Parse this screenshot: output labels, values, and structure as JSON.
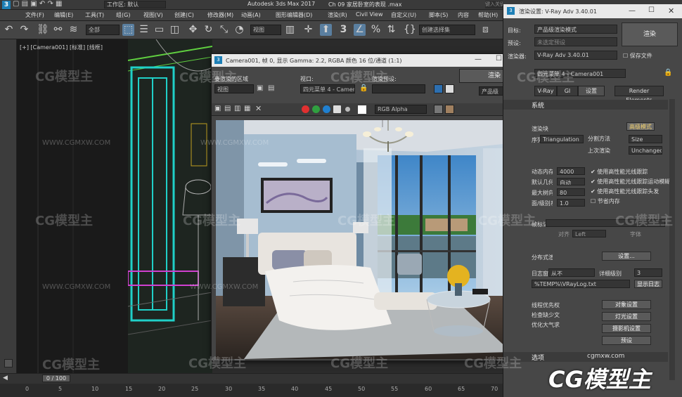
{
  "app": {
    "title": "Autodesk 3ds Max 2017",
    "file": "Ch 09 家居卧室的表现 .max",
    "workspace_label": "工作区: 默认",
    "search_placeholder": "键入关键字或短语"
  },
  "menu": [
    "文件(F)",
    "编辑(E)",
    "工具(T)",
    "组(G)",
    "视图(V)",
    "创建(C)",
    "修改器(M)",
    "动画(A)",
    "图形编辑器(D)",
    "渲染(R)",
    "Civil View",
    "自定义(U)",
    "脚本(S)",
    "内容",
    "帮助(H)"
  ],
  "toolbar": {
    "selection_filter": "全部",
    "view_dropdown": "视图",
    "selection_set": "创建选择集"
  },
  "viewport": {
    "label": "[+] [Camera001] [标准] [线框]"
  },
  "timeline": {
    "frame": "0 / 100",
    "ticks": [
      "0",
      "5",
      "10",
      "15",
      "20",
      "25",
      "30",
      "35",
      "40",
      "45",
      "50",
      "55",
      "60",
      "65",
      "70"
    ]
  },
  "frame_buffer": {
    "title": "Camera001, 帧 0, 显示 Gamma: 2.2, RGBA 颜色 16 位/通道 (1:1)",
    "area_label": "要渲染的区域",
    "area_value": "视图",
    "viewport_label": "视口:",
    "viewport_value": "四元菜单 4 - Camera001",
    "preset_label": "渲染预设:",
    "preset_value": "",
    "render_button": "渲染",
    "quality_value": "产品级",
    "channel_value": "RGB Alpha"
  },
  "render_setup": {
    "title": "渲染设置: V-Ray Adv 3.40.01",
    "target_label": "目标:",
    "target_value": "产品级渲染模式",
    "preset_label": "预设:",
    "preset_value": "未选定预设",
    "renderer_label": "渲染器:",
    "renderer_value": "V-Ray Adv 3.40.01",
    "save_file": "保存文件",
    "render_button": "渲染",
    "view_value": "四元菜单 4 - Camera001",
    "tabs": [
      "V-Ray",
      "GI",
      "设置",
      "Render Elements"
    ],
    "section_system": "系统",
    "bucket_label": "渲染块",
    "seq_label": "序列",
    "seq_value": "Triangulation",
    "split_label": "分割方法",
    "split_value": "Size",
    "prev_label": "上次渲染",
    "prev_value": "Unchanged",
    "advanced_button": "高级模式",
    "raycast_label": "动态内存限制",
    "raycast_value": "4000",
    "geom_label": "默认几何体",
    "geom_value": "自动",
    "depth_label": "最大树向深度",
    "depth_value": "80",
    "face_label": "面/级别系数",
    "face_value": "1.0",
    "checks": [
      "使用高性能光线跟踪",
      "使用高性能光线跟踪运动模糊",
      "使用高性能光线跟踪头发",
      "节省内存"
    ],
    "stamp_label": "帧标记",
    "stamp_align": "对齐",
    "stamp_align_value": "Left",
    "stamp_font": "字体",
    "dist_label": "分布式渲染",
    "dist_button": "设置...",
    "log_label": "日志窗口",
    "log_value": "从不",
    "log_level_label": "详细级别",
    "log_level_value": "3",
    "log_path": "%TEMP%\\VRayLog.txt",
    "show_log": "显示日志",
    "priority_label": "线程优先权",
    "missing_label": "检查缺少文件",
    "optimize_label": "优化大气求值",
    "object_settings": "对象设置",
    "light_settings": "灯光设置",
    "camera_settings": "摄影机设置",
    "presets_button": "预设",
    "section_options": "选项"
  },
  "watermark": {
    "brand": "CG模型主",
    "url": "WWW.CGMXW.COM",
    "url2": "cgmxw.com"
  },
  "colors": {
    "accent_blue": "#5a7fa0",
    "wire_cyan": "#20d0c8",
    "wire_green": "#60d040",
    "red": "#e03030",
    "green": "#30a040",
    "blue": "#2080d0"
  }
}
